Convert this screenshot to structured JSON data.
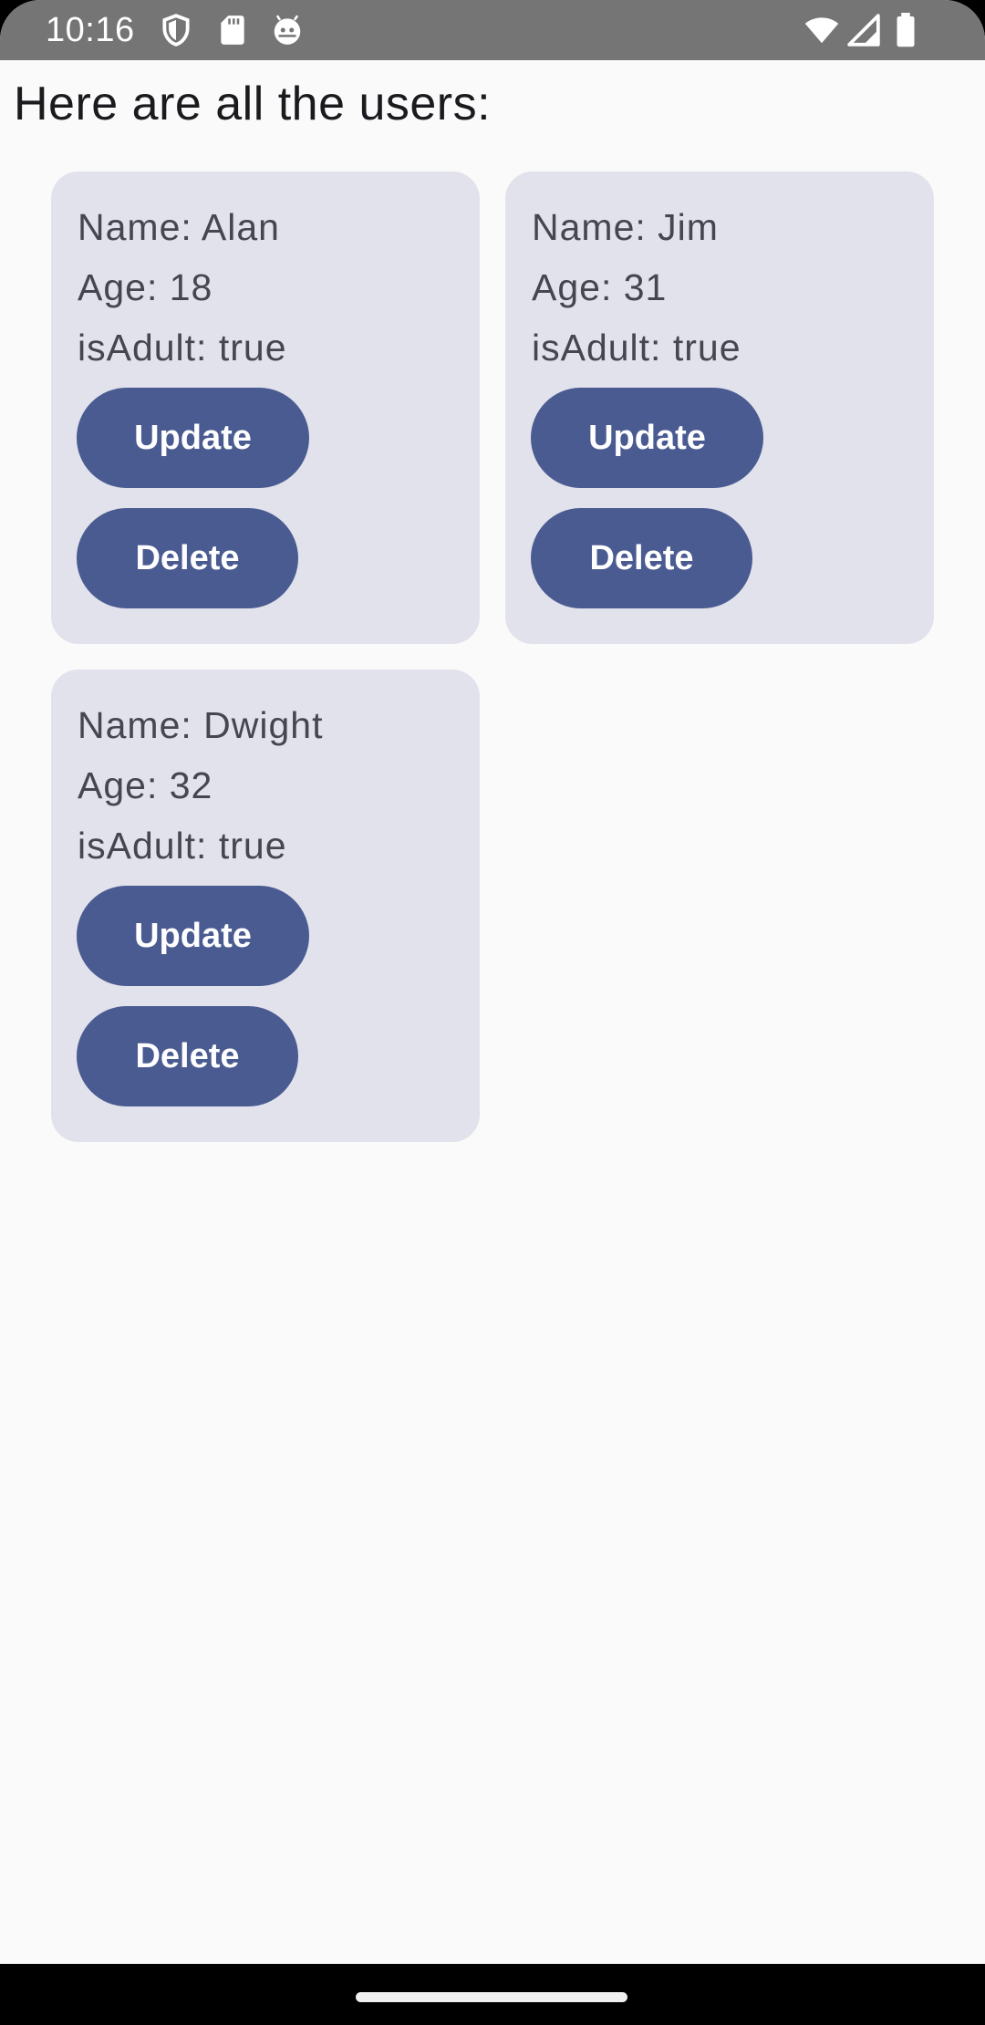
{
  "status_bar": {
    "time": "10:16",
    "left_icons": [
      "shield-icon",
      "sd-card-icon",
      "android-debug-icon"
    ],
    "right_icons": [
      "wifi-icon",
      "cell-signal-icon",
      "battery-icon"
    ]
  },
  "page": {
    "title": "Here are all the users:"
  },
  "users": [
    {
      "name_line": "Name: Alan",
      "age_line": "Age: 18",
      "adult_line": "isAdult: true",
      "update_label": "Update",
      "delete_label": "Delete"
    },
    {
      "name_line": "Name: Jim",
      "age_line": "Age: 31",
      "adult_line": "isAdult: true",
      "update_label": "Update",
      "delete_label": "Delete"
    },
    {
      "name_line": "Name: Dwight",
      "age_line": "Age: 32",
      "adult_line": "isAdult: true",
      "update_label": "Update",
      "delete_label": "Delete"
    }
  ],
  "colors": {
    "card_background": "#e2e2ec",
    "button_primary": "#4a5b91",
    "status_bar": "#757575",
    "screen_background": "#fafafa"
  }
}
